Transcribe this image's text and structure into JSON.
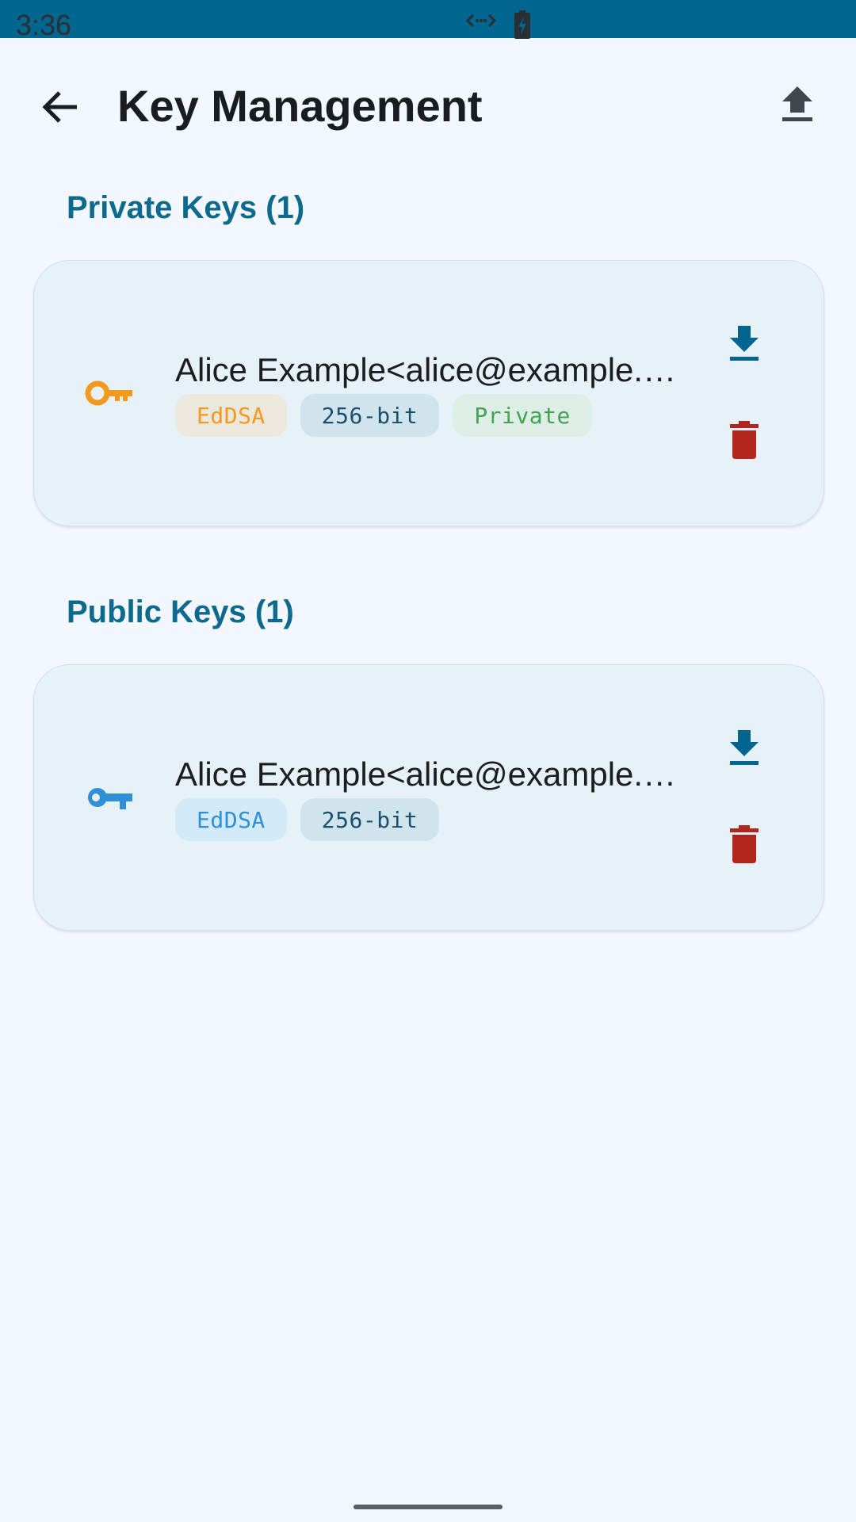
{
  "status_bar": {
    "time": "3:36",
    "icons": [
      "code-icon",
      "battery-charging-icon"
    ]
  },
  "app_bar": {
    "title": "Key Management",
    "back_icon": "arrow-back-icon",
    "action_icon": "upload-icon"
  },
  "sections": [
    {
      "title": "Private Keys (1)",
      "keys": [
        {
          "name": "Alice Example<alice@example.…",
          "icon": "key-icon",
          "icon_color": "#F39A1E",
          "chips": [
            "EdDSA",
            "256-bit",
            "Private"
          ]
        }
      ]
    },
    {
      "title": "Public Keys (1)",
      "keys": [
        {
          "name": "Alice Example<alice@example.…",
          "icon": "key-icon",
          "icon_color": "#2F90D8",
          "chips": [
            "EdDSA",
            "256-bit"
          ]
        }
      ]
    }
  ],
  "colors": {
    "accent": "#00658F",
    "section_title": "#0D6A8E",
    "delete": "#B3261E",
    "background": "#F2F8FE"
  }
}
